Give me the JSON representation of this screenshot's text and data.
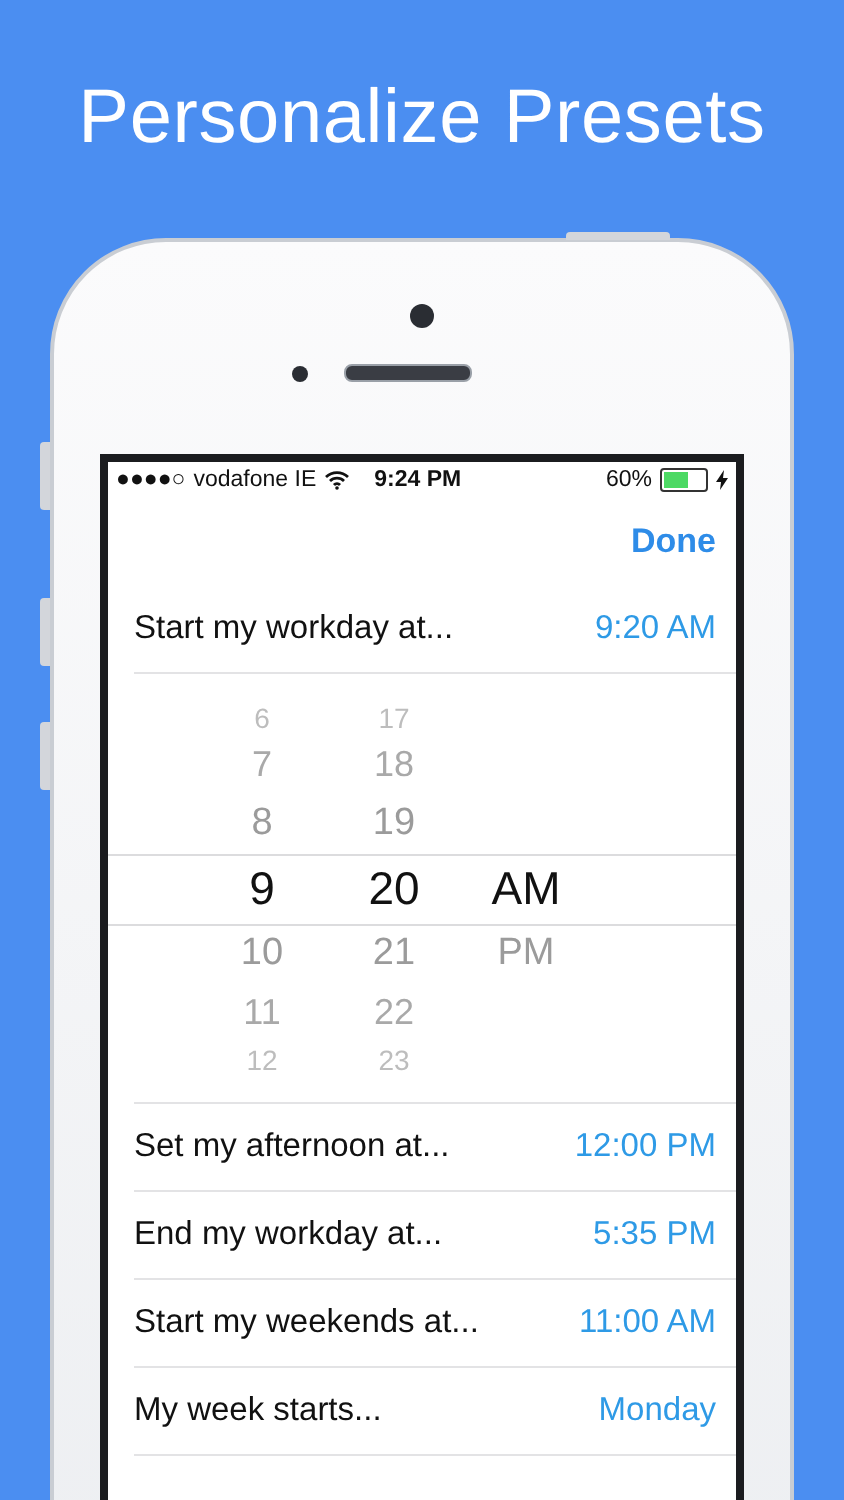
{
  "headline": "Personalize Presets",
  "status_bar": {
    "signal": "●●●●○",
    "carrier": "vodafone IE",
    "time": "9:24 PM",
    "battery_percent": "60%",
    "battery": {
      "level": 0.6,
      "charging": true
    }
  },
  "nav": {
    "done": "Done"
  },
  "first_row": {
    "label": "Start my workday at...",
    "value": "9:20 AM"
  },
  "picker": [
    {
      "items": [
        {
          "text": "6",
          "selected": false
        },
        {
          "text": "7",
          "selected": false
        },
        {
          "text": "8",
          "selected": false
        },
        {
          "text": "9",
          "selected": true
        },
        {
          "text": "10",
          "selected": false
        },
        {
          "text": "11",
          "selected": false
        },
        {
          "text": "12",
          "selected": false
        }
      ]
    },
    {
      "items": [
        {
          "text": "17",
          "selected": false
        },
        {
          "text": "18",
          "selected": false
        },
        {
          "text": "19",
          "selected": false
        },
        {
          "text": "20",
          "selected": true
        },
        {
          "text": "21",
          "selected": false
        },
        {
          "text": "22",
          "selected": false
        },
        {
          "text": "23",
          "selected": false
        }
      ]
    },
    {
      "items": [
        {
          "text": "AM",
          "selected": true
        },
        {
          "text": "PM",
          "selected": false
        }
      ]
    }
  ],
  "rows": [
    {
      "label": "Set my afternoon at...",
      "value": "12:00 PM"
    },
    {
      "label": "End my workday at...",
      "value": "5:35 PM"
    },
    {
      "label": "Start my weekends at...",
      "value": "11:00 AM"
    },
    {
      "label": "My week starts...",
      "value": "Monday"
    }
  ]
}
